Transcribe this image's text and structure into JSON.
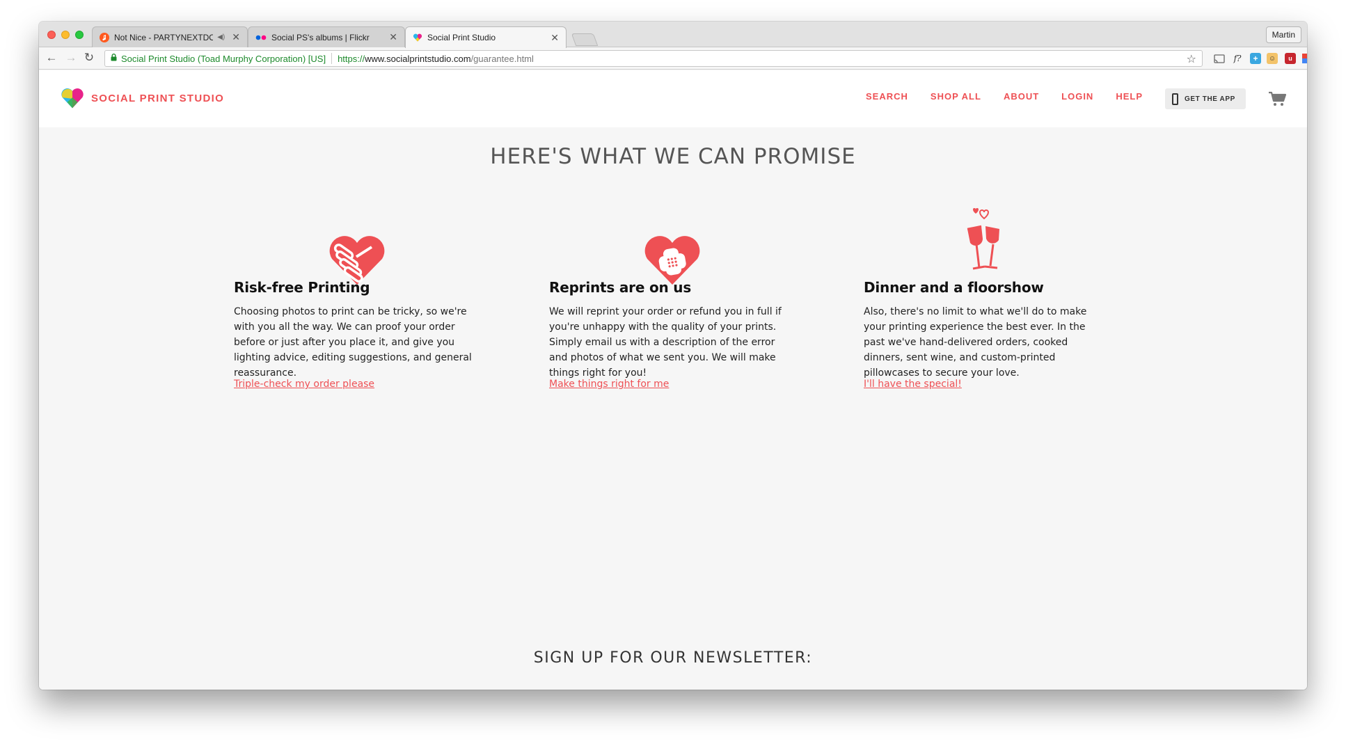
{
  "browser": {
    "tabs": [
      {
        "title": "Not Nice - PARTYNEXTDOC",
        "audio": "◀)",
        "favicon_color": "#ff5a1f"
      },
      {
        "title": "Social PS's albums | Flickr",
        "favicon_color": "#0063dc"
      },
      {
        "title": "Social Print Studio",
        "favicon_color": "#ee5054"
      }
    ],
    "profile_name": "Martin",
    "address": {
      "ev_name": "Social Print Studio (Toad Murphy Corporation) [US]",
      "scheme": "https://",
      "host": "www.socialprintstudio.com",
      "path": "/guarantee.html"
    },
    "icons": [
      "back-icon",
      "forward-icon",
      "reload-icon",
      "star-icon",
      "menu-icon"
    ]
  },
  "site": {
    "brand": "SOCIAL PRINT STUDIO",
    "accent": "#ee5054",
    "nav": [
      "SEARCH",
      "SHOP ALL",
      "ABOUT",
      "LOGIN",
      "HELP"
    ],
    "get_app": "GET THE APP",
    "heading": "HERE'S WHAT WE CAN PROMISE",
    "promises": [
      {
        "icon": "handshake-heart-icon",
        "title": "Risk-free Printing",
        "body": "Choosing photos to print can be tricky, so we're with you all the way. We can proof your order before or just after you place it, and give you lighting advice, editing suggestions, and general reassurance.",
        "link": "Triple-check my order please"
      },
      {
        "icon": "bandaid-heart-icon",
        "title": "Reprints are on us",
        "body": "We will reprint your order or refund you in full if you're unhappy with the quality of your prints. Simply email us with a description of the error and photos of what we sent you. We will make things right for you!",
        "link": "Make things right for me"
      },
      {
        "icon": "wine-glasses-icon",
        "title": "Dinner and a floorshow",
        "body": "Also, there's no limit to what we'll do to make your printing experience the best ever. In the past we've hand-delivered orders, cooked dinners, sent wine, and custom-printed pillowcases to secure your love.",
        "link": "I'll have the special!"
      }
    ],
    "newsletter": "SIGN UP FOR OUR NEWSLETTER:"
  }
}
